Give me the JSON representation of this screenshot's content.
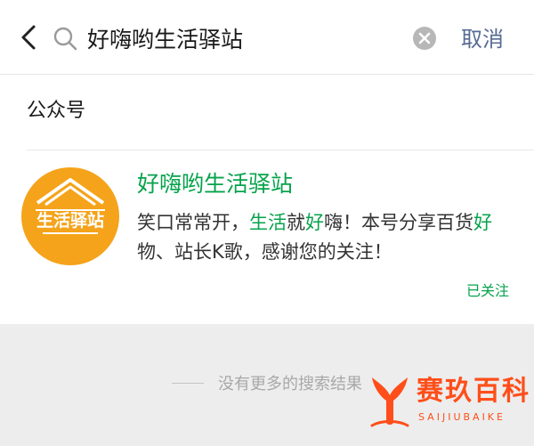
{
  "search": {
    "query": "好嗨哟生活驿站",
    "cancel_label": "取消"
  },
  "results": {
    "section_title": "公众号",
    "account": {
      "name": "好嗨哟生活驿站",
      "avatar_text": "生活驿站",
      "description_parts": [
        {
          "text": "笑口常常开，",
          "highlight": false
        },
        {
          "text": "生活",
          "highlight": true
        },
        {
          "text": "就",
          "highlight": false
        },
        {
          "text": "好",
          "highlight": true
        },
        {
          "text": "嗨！本号分享百货",
          "highlight": false
        },
        {
          "text": "好",
          "highlight": true
        },
        {
          "text": "物、站长K歌，感谢您的关注！",
          "highlight": false
        }
      ],
      "follow_status": "已关注"
    },
    "end_note": "没有更多的搜索结果"
  },
  "watermark": {
    "name": "赛玖百科",
    "pinyin": "SAIJIUBAIKE"
  },
  "icons": {
    "back": "chevron-left-icon",
    "search": "search-icon",
    "clear": "clear-icon",
    "watermark_logo": "whale-tail-logo"
  },
  "colors": {
    "highlight": "#07a34c",
    "link": "#576b95",
    "avatar_bg": "#f5a31a",
    "watermark": "#ff4e1a",
    "page_bg": "#ededed"
  }
}
